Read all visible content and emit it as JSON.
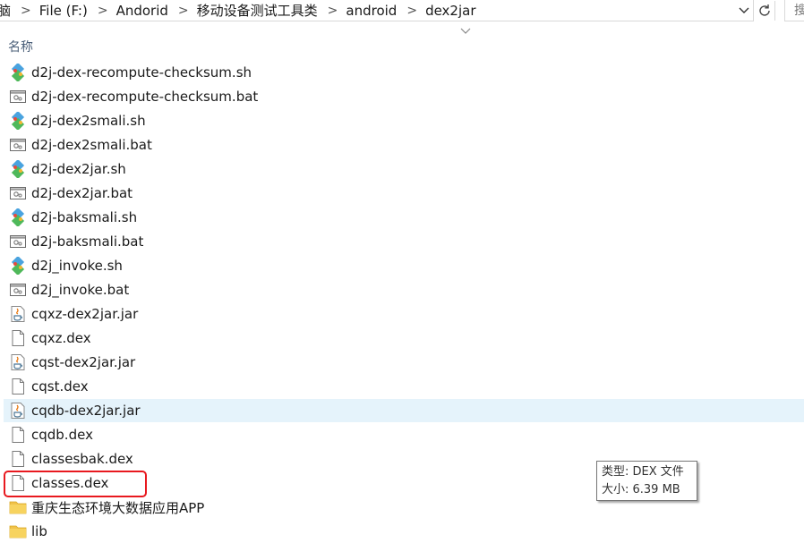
{
  "address_bar": {
    "breadcrumbs": [
      "脑",
      "File (F:)",
      "Andorid",
      "移动设备测试工具类",
      "android",
      "dex2jar"
    ],
    "separator": ">",
    "search_placeholder": "搜"
  },
  "columns": {
    "name_header": "名称"
  },
  "files": [
    {
      "name": "d2j-dex-recompute-checksum.sh",
      "icon": "git-sh-icon"
    },
    {
      "name": "d2j-dex-recompute-checksum.bat",
      "icon": "bat-icon"
    },
    {
      "name": "d2j-dex2smali.sh",
      "icon": "git-sh-icon"
    },
    {
      "name": "d2j-dex2smali.bat",
      "icon": "bat-icon"
    },
    {
      "name": "d2j-dex2jar.sh",
      "icon": "git-sh-icon"
    },
    {
      "name": "d2j-dex2jar.bat",
      "icon": "bat-icon"
    },
    {
      "name": "d2j-baksmali.sh",
      "icon": "git-sh-icon"
    },
    {
      "name": "d2j-baksmali.bat",
      "icon": "bat-icon"
    },
    {
      "name": "d2j_invoke.sh",
      "icon": "git-sh-icon"
    },
    {
      "name": "d2j_invoke.bat",
      "icon": "bat-icon"
    },
    {
      "name": "cqxz-dex2jar.jar",
      "icon": "java-jar-icon"
    },
    {
      "name": "cqxz.dex",
      "icon": "blank-file-icon"
    },
    {
      "name": "cqst-dex2jar.jar",
      "icon": "java-jar-icon"
    },
    {
      "name": "cqst.dex",
      "icon": "blank-file-icon"
    },
    {
      "name": "cqdb-dex2jar.jar",
      "icon": "java-jar-icon",
      "hovered": true
    },
    {
      "name": "cqdb.dex",
      "icon": "blank-file-icon"
    },
    {
      "name": "classesbak.dex",
      "icon": "blank-file-icon"
    },
    {
      "name": "classes.dex",
      "icon": "blank-file-icon",
      "highlighted": true
    },
    {
      "name": "重庆生态环境大数据应用APP",
      "icon": "folder-icon"
    },
    {
      "name": "lib",
      "icon": "folder-icon"
    }
  ],
  "tooltip": {
    "type_line": "类型: DEX 文件",
    "size_line": "大小: 6.39 MB"
  },
  "colors": {
    "hover_row": "#e5f3fb",
    "highlight_border": "#e8191f",
    "header_text": "#4c607a",
    "folder": "#f0c24b"
  }
}
